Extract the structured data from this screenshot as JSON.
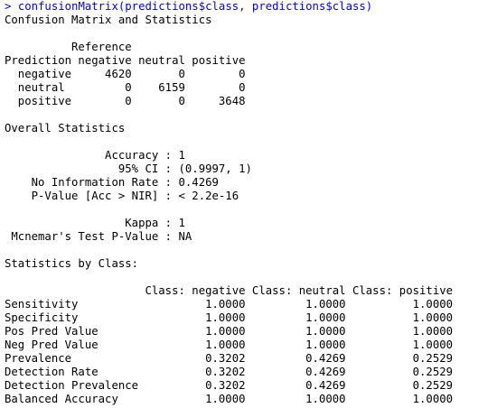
{
  "console": {
    "prompt": ">",
    "command": "confusionMatrix(predictions$class, predictions$class)",
    "output_lines": [
      "Confusion Matrix and Statistics",
      "",
      "          Reference",
      "Prediction negative neutral positive",
      "  negative     4620       0        0",
      "  neutral         0    6159        0",
      "  positive        0       0     3648",
      "",
      "Overall Statistics",
      "",
      "               Accuracy : 1",
      "                 95% CI : (0.9997, 1)",
      "    No Information Rate : 0.4269",
      "    P-Value [Acc > NIR] : < 2.2e-16",
      "",
      "                  Kappa : 1",
      " Mcnemar's Test P-Value : NA",
      "",
      "Statistics by Class:",
      "",
      "                     Class: negative Class: neutral Class: positive",
      "Sensitivity                   1.0000         1.0000          1.0000",
      "Specificity                   1.0000         1.0000          1.0000",
      "Pos Pred Value                1.0000         1.0000          1.0000",
      "Neg Pred Value                1.0000         1.0000          1.0000",
      "Prevalence                    0.3202         0.4269          0.2529",
      "Detection Rate                0.3202         0.4269          0.2529",
      "Detection Prevalence          0.3202         0.4269          0.2529",
      "Balanced Accuracy             1.0000         1.0000          1.0000"
    ]
  }
}
